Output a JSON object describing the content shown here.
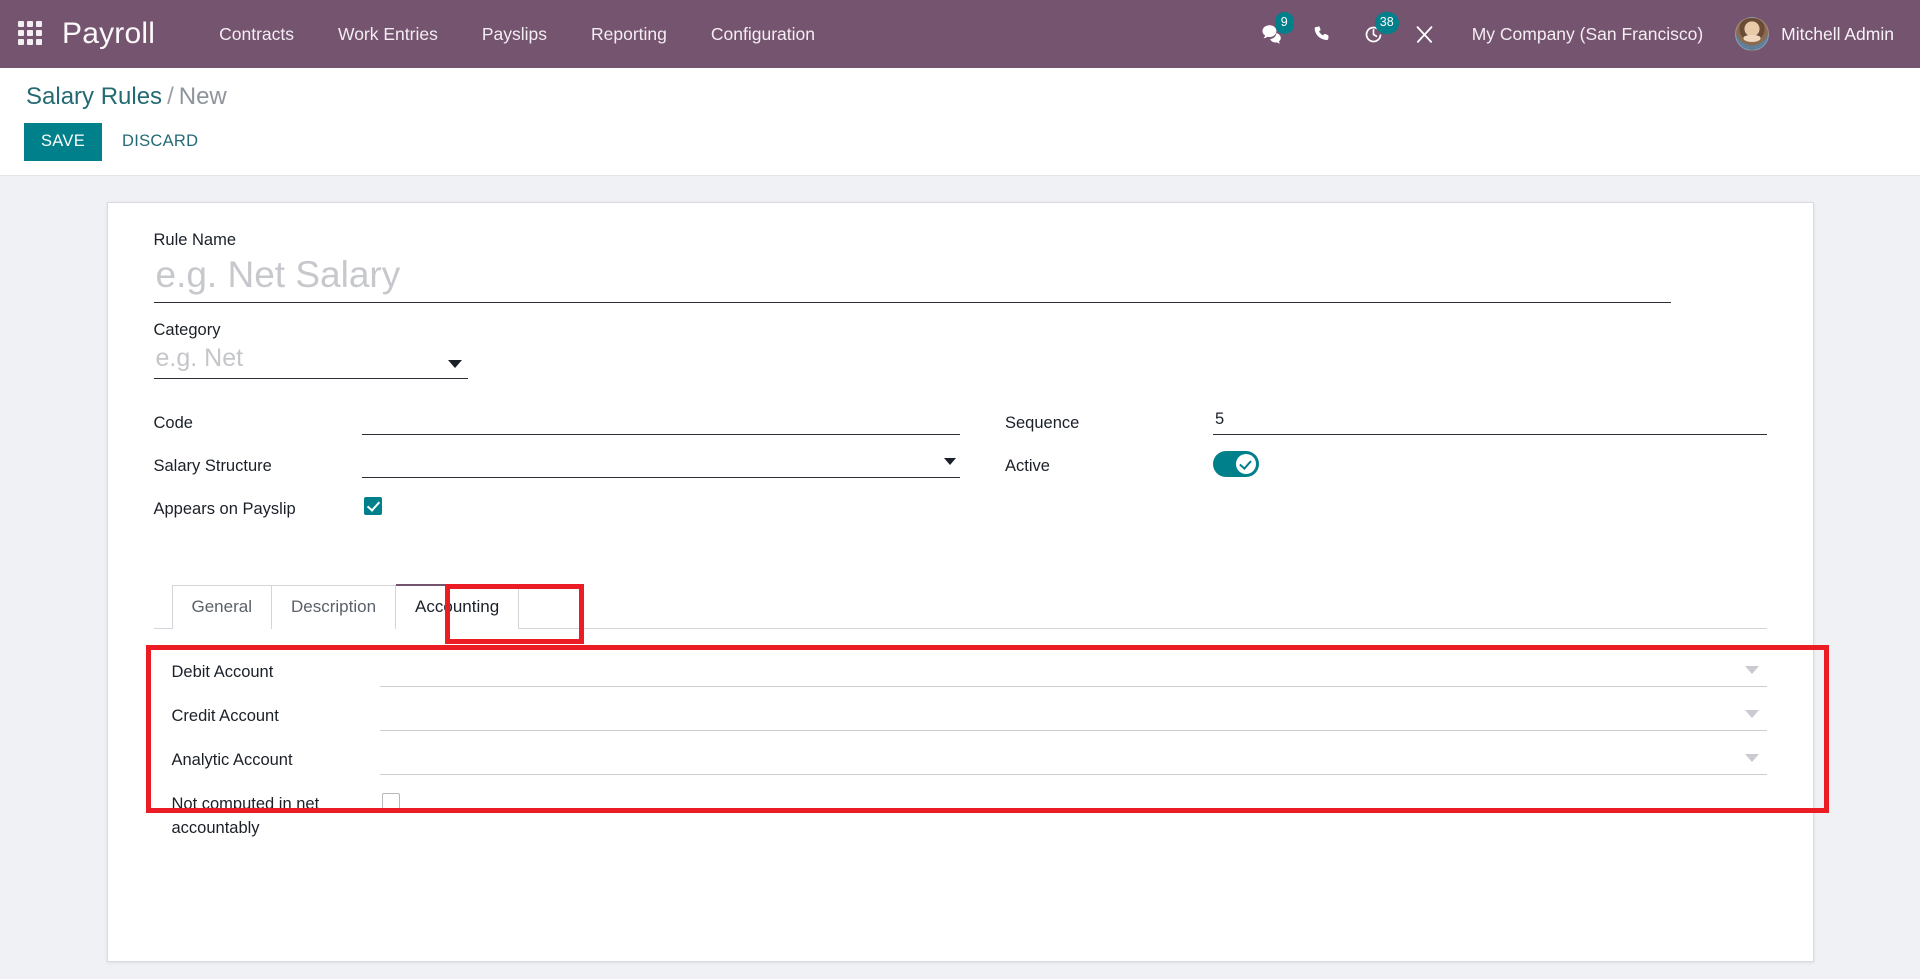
{
  "navbar": {
    "apps_icon": "apps-grid-icon",
    "brand": "Payroll",
    "menu": [
      {
        "label": "Contracts"
      },
      {
        "label": "Work Entries"
      },
      {
        "label": "Payslips"
      },
      {
        "label": "Reporting"
      },
      {
        "label": "Configuration"
      }
    ],
    "icons": {
      "messages": {
        "name": "messages-icon",
        "badge": "9"
      },
      "phone": {
        "name": "phone-icon",
        "badge": ""
      },
      "activities": {
        "name": "activity-clock-icon",
        "badge": "38"
      },
      "tools": {
        "name": "tools-icon",
        "badge": ""
      }
    },
    "company": "My Company (San Francisco)",
    "user": "Mitchell Admin",
    "bg_color": "#74546e"
  },
  "breadcrumb": {
    "parent": "Salary Rules",
    "separator": "/",
    "current": "New"
  },
  "actions": {
    "save": "SAVE",
    "discard": "DISCARD",
    "save_color": "#00808a"
  },
  "form": {
    "rule_name": {
      "label": "Rule Name",
      "value": "",
      "placeholder": "e.g. Net Salary"
    },
    "category": {
      "label": "Category",
      "value": "",
      "placeholder": "e.g. Net"
    },
    "code": {
      "label": "Code",
      "value": "",
      "placeholder": ""
    },
    "salary_structure": {
      "label": "Salary Structure",
      "value": "",
      "placeholder": ""
    },
    "appears_on_payslip": {
      "label": "Appears on Payslip",
      "checked": true
    },
    "sequence": {
      "label": "Sequence",
      "value": "5",
      "placeholder": ""
    },
    "active": {
      "label": "Active",
      "on": true
    }
  },
  "notebook": {
    "tabs": [
      {
        "label": "General",
        "active": false
      },
      {
        "label": "Description",
        "active": false
      },
      {
        "label": "Accounting",
        "active": true
      }
    ],
    "accounting": {
      "debit_account": {
        "label": "Debit Account",
        "value": "",
        "placeholder": ""
      },
      "credit_account": {
        "label": "Credit Account",
        "value": "",
        "placeholder": ""
      },
      "analytic_account": {
        "label": "Analytic Account",
        "value": "",
        "placeholder": ""
      },
      "not_computed": {
        "label": "Not computed in net accountably",
        "checked": false
      }
    }
  },
  "annotations": {
    "color": "#ec1c24",
    "tab_highlight": "Accounting",
    "panel_highlight": "Accounting tab fields"
  }
}
